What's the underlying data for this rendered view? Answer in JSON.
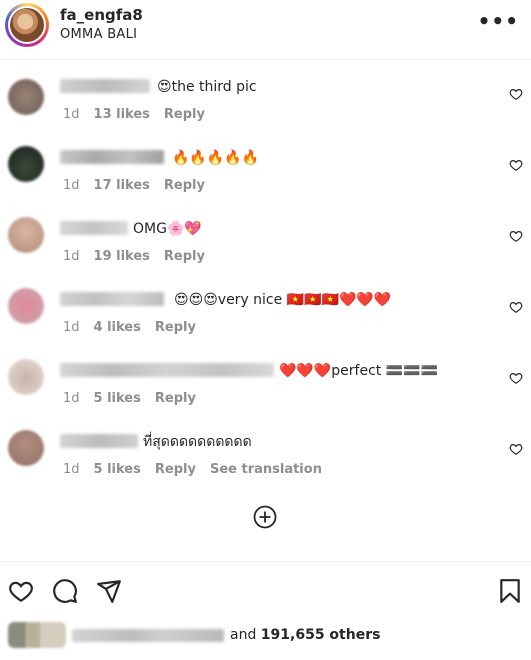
{
  "post": {
    "username": "fa_engfa8",
    "location": "OMMA BALI"
  },
  "comments": [
    {
      "text": "😍the third pic",
      "time": "1d",
      "likes": "13 likes",
      "reply": "Reply",
      "translate": ""
    },
    {
      "text": "🔥🔥🔥🔥🔥",
      "time": "1d",
      "likes": "17 likes",
      "reply": "Reply",
      "translate": ""
    },
    {
      "text": "OMG🌸💖",
      "time": "1d",
      "likes": "19 likes",
      "reply": "Reply",
      "translate": ""
    },
    {
      "text": "😍😍😍very nice 🇻🇳🇻🇳🇻🇳❤️❤️❤️",
      "time": "1d",
      "likes": "4 likes",
      "reply": "Reply",
      "translate": ""
    },
    {
      "text": "❤️❤️❤️perfect 🟰🟰🟰",
      "time": "1d",
      "likes": "5 likes",
      "reply": "Reply",
      "translate": ""
    },
    {
      "text": "ที่สุดดดดดดดดดด",
      "time": "1d",
      "likes": "5 likes",
      "reply": "Reply",
      "translate": "See translation"
    }
  ],
  "likes_summary": {
    "prefix": "and ",
    "count": "191,655 others"
  },
  "icons": {
    "more": "more-options-icon",
    "comment_like": "heart-outline-icon",
    "add": "add-comment-icon",
    "like": "heart-icon",
    "comment": "comment-icon",
    "share": "share-icon",
    "save": "bookmark-icon"
  }
}
